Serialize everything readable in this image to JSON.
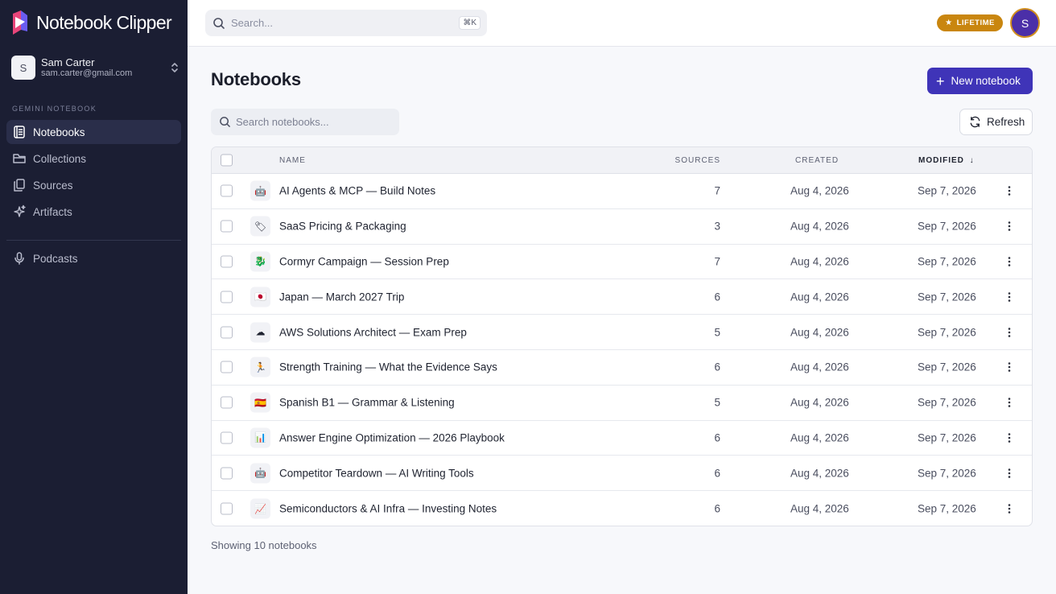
{
  "app": {
    "name": "Notebook Clipper"
  },
  "user": {
    "initial": "S",
    "name": "Sam Carter",
    "email": "sam.carter@gmail.com"
  },
  "sidebar": {
    "section_label": "GEMINI NOTEBOOK",
    "items": [
      {
        "label": "Notebooks",
        "icon": "notebook-icon",
        "active": true
      },
      {
        "label": "Collections",
        "icon": "folder-icon",
        "active": false
      },
      {
        "label": "Sources",
        "icon": "files-icon",
        "active": false
      },
      {
        "label": "Artifacts",
        "icon": "sparkles-icon",
        "active": false
      }
    ],
    "secondary_items": [
      {
        "label": "Podcasts",
        "icon": "microphone-icon"
      }
    ]
  },
  "topbar": {
    "search_placeholder": "Search...",
    "search_shortcut": "⌘K",
    "plan_badge": "LIFETIME",
    "avatar_initial": "S"
  },
  "main": {
    "title": "Notebooks",
    "new_button": "New notebook",
    "search_placeholder": "Search notebooks...",
    "refresh_button": "Refresh",
    "columns": {
      "name": "NAME",
      "sources": "SOURCES",
      "created": "CREATED",
      "modified": "MODIFIED"
    },
    "rows": [
      {
        "emoji": "🤖",
        "name": "AI Agents & MCP — Build Notes",
        "sources": "7",
        "created": "Aug 4, 2026",
        "modified": "Sep 7, 2026"
      },
      {
        "emoji": "🏷",
        "name": "SaaS Pricing & Packaging",
        "sources": "3",
        "created": "Aug 4, 2026",
        "modified": "Sep 7, 2026"
      },
      {
        "emoji": "🐉",
        "name": "Cormyr Campaign — Session Prep",
        "sources": "7",
        "created": "Aug 4, 2026",
        "modified": "Sep 7, 2026"
      },
      {
        "emoji": "🇯🇵",
        "name": "Japan — March 2027 Trip",
        "sources": "6",
        "created": "Aug 4, 2026",
        "modified": "Sep 7, 2026"
      },
      {
        "emoji": "☁",
        "name": "AWS Solutions Architect — Exam Prep",
        "sources": "5",
        "created": "Aug 4, 2026",
        "modified": "Sep 7, 2026"
      },
      {
        "emoji": "🏃",
        "name": "Strength Training — What the Evidence Says",
        "sources": "6",
        "created": "Aug 4, 2026",
        "modified": "Sep 7, 2026"
      },
      {
        "emoji": "🇪🇸",
        "name": "Spanish B1 — Grammar & Listening",
        "sources": "5",
        "created": "Aug 4, 2026",
        "modified": "Sep 7, 2026"
      },
      {
        "emoji": "📊",
        "name": "Answer Engine Optimization — 2026 Playbook",
        "sources": "6",
        "created": "Aug 4, 2026",
        "modified": "Sep 7, 2026"
      },
      {
        "emoji": "🤖",
        "name": "Competitor Teardown — AI Writing Tools",
        "sources": "6",
        "created": "Aug 4, 2026",
        "modified": "Sep 7, 2026"
      },
      {
        "emoji": "📈",
        "name": "Semiconductors & AI Infra — Investing Notes",
        "sources": "6",
        "created": "Aug 4, 2026",
        "modified": "Sep 7, 2026"
      }
    ],
    "footer": "Showing 10 notebooks"
  },
  "colors": {
    "sidebar_bg": "#1b1e33",
    "accent": "#3f34b8",
    "badge": "#c9860f"
  }
}
